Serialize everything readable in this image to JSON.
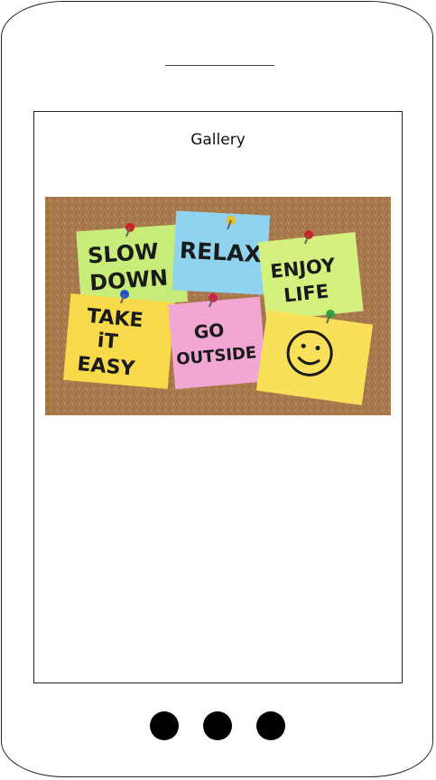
{
  "screen": {
    "title": "Gallery"
  },
  "image": {
    "notes": [
      {
        "line1": "SLOW",
        "line2": "DOWN",
        "color": "#c8ec7a"
      },
      {
        "line1": "RELAX",
        "line2": "",
        "color": "#8fd3ee"
      },
      {
        "line1": "ENJOY",
        "line2": "LIFE",
        "color": "#d4f07e"
      },
      {
        "line1": "TAKE",
        "line2": "iT",
        "line3": "EASY",
        "color": "#f7d94a"
      },
      {
        "line1": "GO",
        "line2": "OUTSIDE",
        "color": "#f2a6d3"
      },
      {
        "smiley": true,
        "color": "#f8e05a"
      }
    ],
    "background_color": "#a87a4e"
  },
  "nav": {
    "dots": 3
  }
}
